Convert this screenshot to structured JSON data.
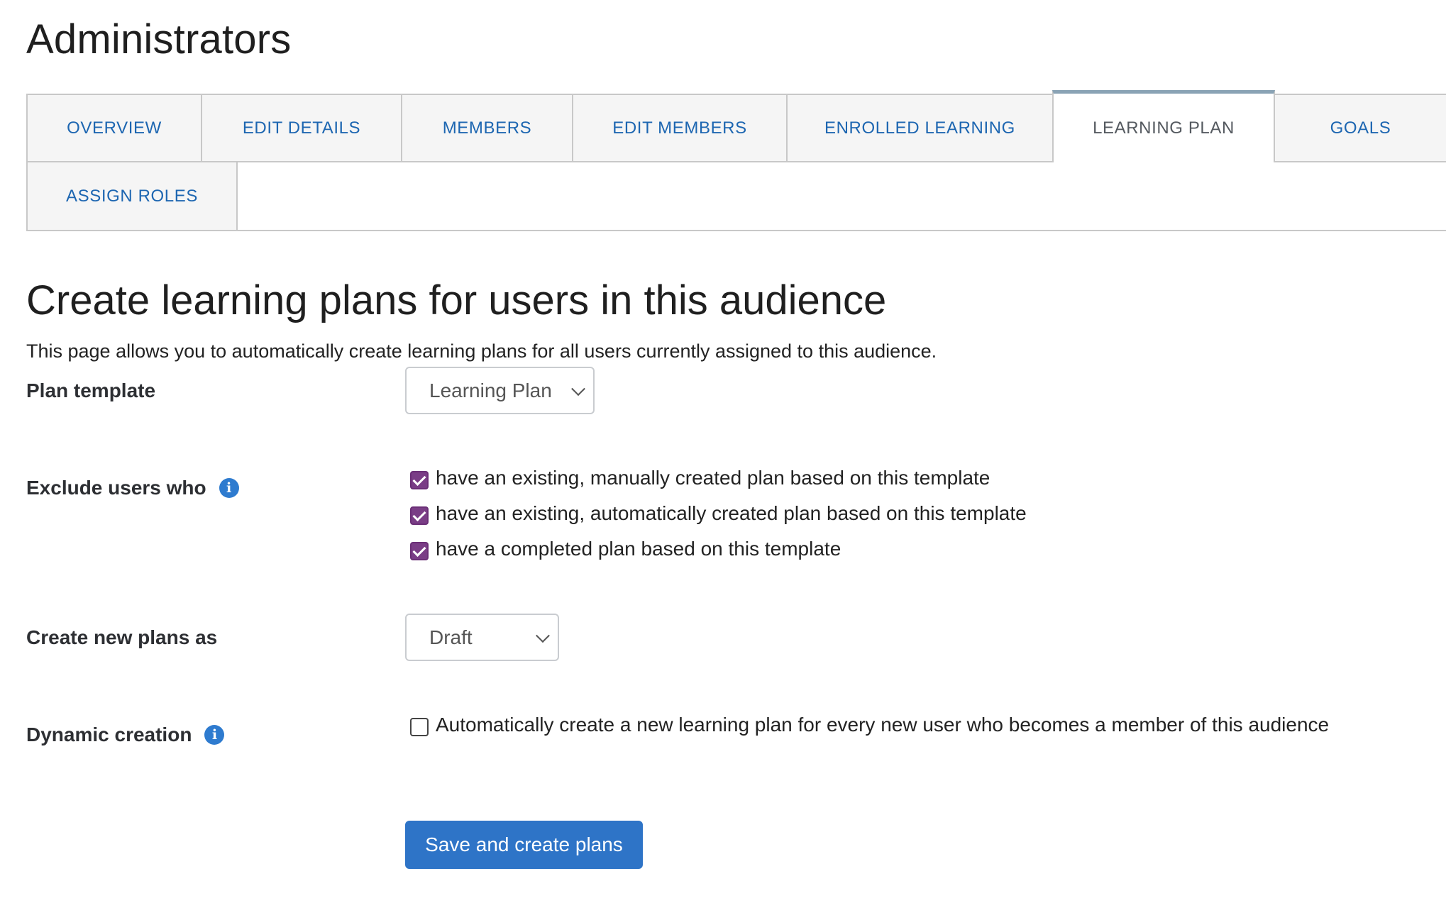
{
  "page": {
    "title": "Administrators"
  },
  "tabs": [
    {
      "label": "OVERVIEW",
      "active": false
    },
    {
      "label": "EDIT DETAILS",
      "active": false
    },
    {
      "label": "MEMBERS",
      "active": false
    },
    {
      "label": "EDIT MEMBERS",
      "active": false
    },
    {
      "label": "ENROLLED LEARNING",
      "active": false
    },
    {
      "label": "LEARNING PLAN",
      "active": true
    },
    {
      "label": "GOALS",
      "active": false
    },
    {
      "label": "ASSIGN ROLES",
      "active": false
    }
  ],
  "main": {
    "heading": "Create learning plans for users in this audience",
    "description": "This page allows you to automatically create learning plans for all users currently assigned to this audience."
  },
  "form": {
    "plan_template": {
      "label": "Plan template",
      "selected": "Learning Plan"
    },
    "exclude_users": {
      "label": "Exclude users who",
      "info_icon": "info-icon",
      "options": [
        {
          "label": "have an existing, manually created plan based on this template",
          "checked": true
        },
        {
          "label": "have an existing, automatically created plan based on this template",
          "checked": true
        },
        {
          "label": "have a completed plan based on this template",
          "checked": true
        }
      ]
    },
    "create_as": {
      "label": "Create new plans as",
      "selected": "Draft"
    },
    "dynamic_creation": {
      "label": "Dynamic creation",
      "info_icon": "info-icon",
      "option": {
        "label": "Automatically create a new learning plan for every new user who becomes a member of this audience",
        "checked": false
      }
    },
    "submit_label": "Save and create plans"
  },
  "colors": {
    "link": "#1d66b1",
    "active_tab_border": "#8aa3b5",
    "checkbox_checked": "#7a3d86",
    "primary_button": "#2e74c7",
    "info_icon": "#2e7bcf"
  }
}
